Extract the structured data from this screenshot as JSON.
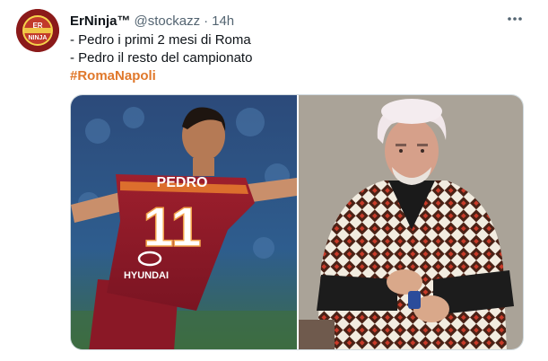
{
  "tweet": {
    "author_name": "ErNinja™",
    "author_handle": "@stockazz",
    "separator": "·",
    "timestamp": "14h",
    "avatar_text": "ER NINJA",
    "lines": [
      "- Pedro i primi 2 mesi di Roma",
      "- Pedro il resto del campionato"
    ],
    "hashtag": "#RomaNapoli",
    "accent_color": "#e0782b",
    "more_icon": "more-horizontal-icon",
    "media": {
      "left_jersey_name": "PEDRO",
      "left_jersey_number": "11",
      "left_sponsor": "HYUNDAI"
    }
  }
}
